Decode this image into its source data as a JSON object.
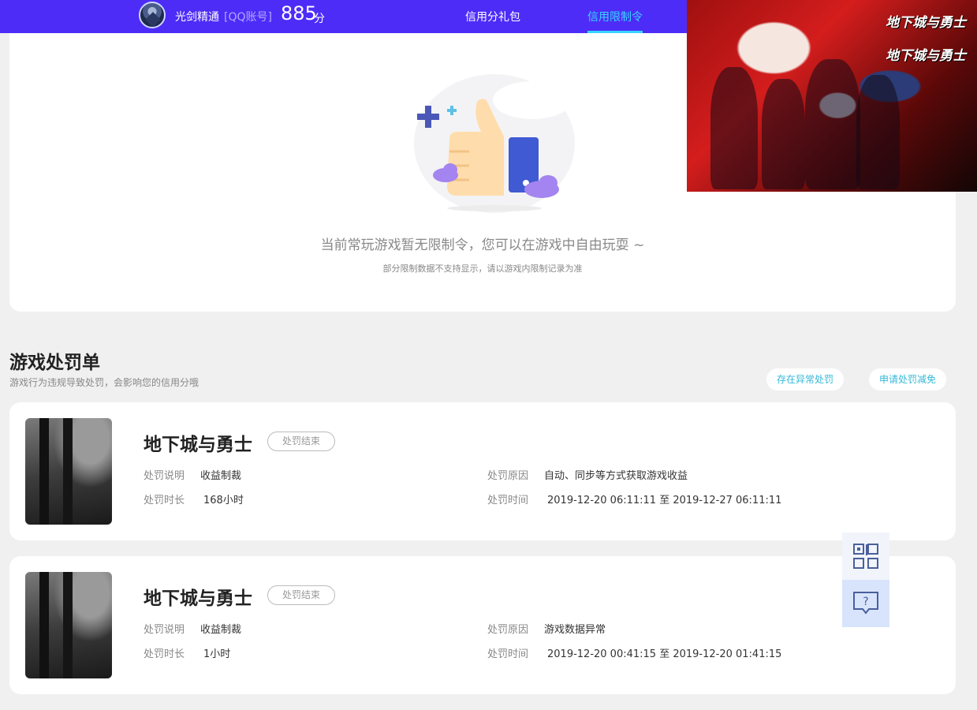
{
  "header": {
    "user_name": "光剑精通",
    "account_type": "[QQ账号]",
    "score": "885",
    "score_unit": "分",
    "tabs": [
      {
        "label": "信用分礼包",
        "active": false
      },
      {
        "label": "信用限制令",
        "active": true
      }
    ],
    "colors": {
      "bar": "#4d2cf8",
      "active_tab": "#37d6ff"
    }
  },
  "banner": {
    "logo_text": "地下城与勇士"
  },
  "empty_state": {
    "title": "当前常玩游戏暂无限制令，您可以在游戏中自由玩耍 ~",
    "subtitle": "部分限制数据不支持显示，请以游戏内限制记录为准"
  },
  "penalty_section": {
    "title": "游戏处罚单",
    "subtitle": "游戏行为违规导致处罚，会影响您的信用分哦",
    "buttons": {
      "abnormal": "存在异常处罚",
      "reduce": "申请处罚减免"
    },
    "labels": {
      "description": "处罚说明",
      "duration": "处罚时长",
      "reason": "处罚原因",
      "time": "处罚时间"
    },
    "items": [
      {
        "game": "地下城与勇士",
        "status": "处罚结束",
        "description": "收益制裁",
        "duration": "168小时",
        "reason": "自动、同步等方式获取游戏收益",
        "time": "2019-12-20 06:11:11 至 2019-12-27 06:11:11"
      },
      {
        "game": "地下城与勇士",
        "status": "处罚结束",
        "description": "收益制裁",
        "duration": "1小时",
        "reason": "游戏数据异常",
        "time": "2019-12-20 00:41:15 至 2019-12-20 01:41:15"
      }
    ]
  },
  "float_buttons": {
    "qr_icon": "qr-code-icon",
    "help_icon": "help-chat-icon"
  }
}
